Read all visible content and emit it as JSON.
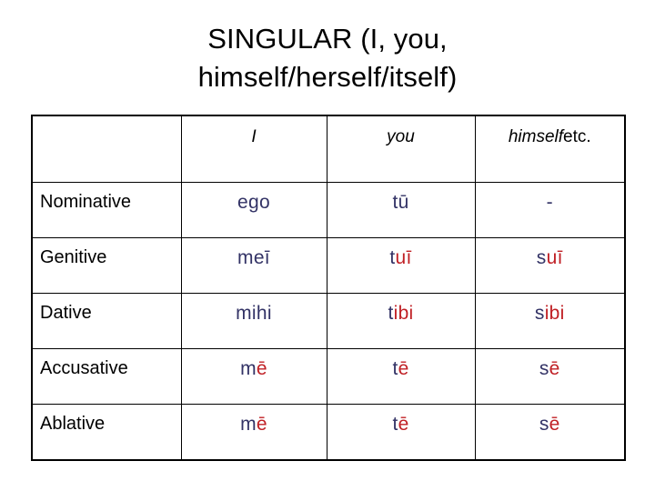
{
  "slide": {
    "title": "SINGULAR (I, you, himself/herself/itself)",
    "title_line1": "SINGULAR (I, you,",
    "title_line2": "himself/herself/itself)"
  },
  "colors": {
    "navy": "#333366",
    "red": "#c02025",
    "text": "#000000",
    "border": "#000000",
    "background": "#ffffff"
  },
  "table": {
    "headers": {
      "case_column": "",
      "first_person": "I",
      "second_person": "you",
      "third_person_italic": "himself",
      "third_person_plain": "etc."
    },
    "rows": [
      {
        "case": "Nominative",
        "first": {
          "text": "ego",
          "navy": "ego",
          "red": ""
        },
        "second": {
          "text": "tū",
          "navy": "tū",
          "red": ""
        },
        "third": {
          "text": "-",
          "navy": "-",
          "red": ""
        }
      },
      {
        "case": "Genitive",
        "first": {
          "text": "meī",
          "navy": "meī",
          "red": ""
        },
        "second": {
          "text": "tuī",
          "navy": "t",
          "red": "uī"
        },
        "third": {
          "text": "suī",
          "navy": "s",
          "red": "uī"
        }
      },
      {
        "case": "Dative",
        "first": {
          "text": "mihi",
          "navy": "mihi",
          "red": ""
        },
        "second": {
          "text": "tibi",
          "navy": "t",
          "red": "ibi"
        },
        "third": {
          "text": "sibi",
          "navy": "s",
          "red": "ibi"
        }
      },
      {
        "case": "Accusative",
        "first": {
          "text": "mē",
          "navy": "m",
          "red": "ē"
        },
        "second": {
          "text": "tē",
          "navy": "t",
          "red": "ē"
        },
        "third": {
          "text": "sē",
          "navy": "s",
          "red": "ē"
        }
      },
      {
        "case": "Ablative",
        "first": {
          "text": "mē",
          "navy": "m",
          "red": "ē"
        },
        "second": {
          "text": "tē",
          "navy": "t",
          "red": "ē"
        },
        "third": {
          "text": "sē",
          "navy": "s",
          "red": "ē"
        }
      }
    ]
  }
}
